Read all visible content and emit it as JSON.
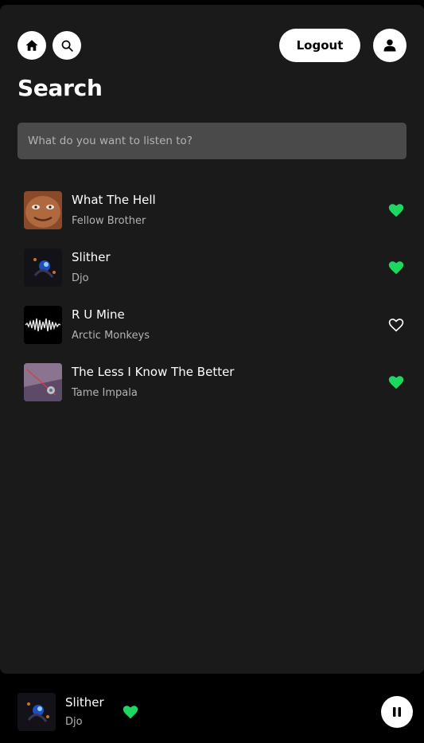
{
  "header": {
    "home_icon": "home-icon",
    "search_icon": "search-icon",
    "logout_label": "Logout",
    "profile_icon": "user-icon"
  },
  "page": {
    "title": "Search"
  },
  "search": {
    "placeholder": "What do you want to listen to?",
    "value": ""
  },
  "results": [
    {
      "title": "What The Hell",
      "artist": "Fellow Brother",
      "liked": true
    },
    {
      "title": "Slither",
      "artist": "Djo",
      "liked": true
    },
    {
      "title": "R U Mine",
      "artist": "Arctic Monkeys",
      "liked": false
    },
    {
      "title": "The Less I Know The Better",
      "artist": "Tame Impala",
      "liked": true
    }
  ],
  "player": {
    "title": "Slither",
    "artist": "Djo",
    "liked": true,
    "state_icon": "pause-icon"
  },
  "colors": {
    "accent": "#1ed760",
    "panel": "#1a1a1a",
    "background": "#000000",
    "input": "#4a4a4a",
    "muted_text": "#b3b3b3"
  }
}
